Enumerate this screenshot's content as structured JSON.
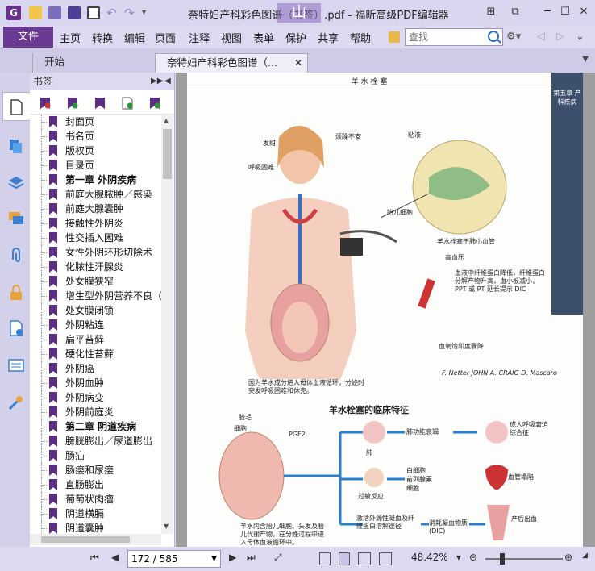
{
  "window": {
    "title": "奈特妇产科彩色图谱（书签）.pdf - 福昕高级PDF编辑器",
    "watermark": "山"
  },
  "menu": {
    "file": "文件",
    "items": [
      "主页",
      "转换",
      "编辑",
      "页面",
      "注释",
      "视图",
      "表单",
      "保护",
      "共享",
      "帮助"
    ],
    "search_placeholder": "查找"
  },
  "tabs": {
    "home": "开始",
    "document": "奈特妇产科彩色图谱（..."
  },
  "bookmarks": {
    "header": "书签",
    "items": [
      {
        "label": "封面页",
        "bold": false
      },
      {
        "label": "书名页",
        "bold": false
      },
      {
        "label": "版权页",
        "bold": false
      },
      {
        "label": "目录页",
        "bold": false
      },
      {
        "label": "第一章   外阴疾病",
        "bold": true
      },
      {
        "label": "前庭大腺脓肿／感染",
        "bold": false
      },
      {
        "label": "前庭大腺囊肿",
        "bold": false
      },
      {
        "label": "接触性外阴炎",
        "bold": false
      },
      {
        "label": "性交插入困难",
        "bold": false
      },
      {
        "label": "女性外阴环形切除术",
        "bold": false
      },
      {
        "label": "化脓性汗腺炎",
        "bold": false
      },
      {
        "label": "处女膜狭窄",
        "bold": false
      },
      {
        "label": "增生型外阴营养不良（",
        "bold": false
      },
      {
        "label": "处女膜闭锁",
        "bold": false
      },
      {
        "label": "外阴粘连",
        "bold": false
      },
      {
        "label": "扁平苔藓",
        "bold": false
      },
      {
        "label": "硬化性苔藓",
        "bold": false
      },
      {
        "label": "外阴癌",
        "bold": false
      },
      {
        "label": "外阴血肿",
        "bold": false
      },
      {
        "label": "外阴病变",
        "bold": false
      },
      {
        "label": "外阴前庭炎",
        "bold": false
      },
      {
        "label": "第二章   阴道疾病",
        "bold": true
      },
      {
        "label": "膀胱膨出／尿道膨出",
        "bold": false
      },
      {
        "label": "肠疝",
        "bold": false
      },
      {
        "label": "肠瘘和尿瘘",
        "bold": false
      },
      {
        "label": "直肠膨出",
        "bold": false
      },
      {
        "label": "葡萄状肉瘤",
        "bold": false
      },
      {
        "label": "阴道横膈",
        "bold": false
      },
      {
        "label": "阴道囊肿",
        "bold": false
      }
    ]
  },
  "page": {
    "header": "羊 水 栓 塞",
    "chapter_strip": "第五章 产科疾病",
    "labels": {
      "sweat": "发绀",
      "anxiety": "烦躁不安",
      "dyspnea": "呼吸困难",
      "mucus": "粘液",
      "fetal_cells": "胎儿细胞",
      "emboli": "羊水栓塞于肺小血管",
      "hypotension": "高血压",
      "coag": "血液中纤维蛋白降低，纤维蛋白分解产物升高，血小板减小，PPT 或 PT 延长提示 DIC",
      "oxygen": "血氧饱和度骤降",
      "hair": "胎毛",
      "cells": "细胞",
      "pgf": "PGF2",
      "lung": "肺",
      "lung_fail": "肺功能衰竭",
      "adult_resp": "成人呼吸窘迫综合征",
      "leuko": "白细胞",
      "prosta": "前列腺素",
      "cytokine": "细胞",
      "allergic": "过敏反应",
      "heart": "血管塌陷",
      "activate": "激活外源性凝血及纤维蛋白溶解途径",
      "dic": "消耗凝血物质(DIC)",
      "pph": "产后出血"
    },
    "caption_top": "因为羊水成分进入母体血液循环，分娩时突发呼吸困难和休克。",
    "subtitle": "羊水栓塞的临床特征",
    "caption_bottom": "羊水内含胎儿细胞、头发及胎儿代谢产物，在分娩过程中进入母体血液循环中。",
    "signature": "F. Netter  JOHN A. CRAIG  D. Mascaro"
  },
  "status": {
    "page_value": "172 / 585",
    "zoom": "48.42%"
  },
  "colors": {
    "accent": "#6b3a92",
    "bookmark_icon": "#5c2d84",
    "chrome": "#dcd9f0"
  }
}
